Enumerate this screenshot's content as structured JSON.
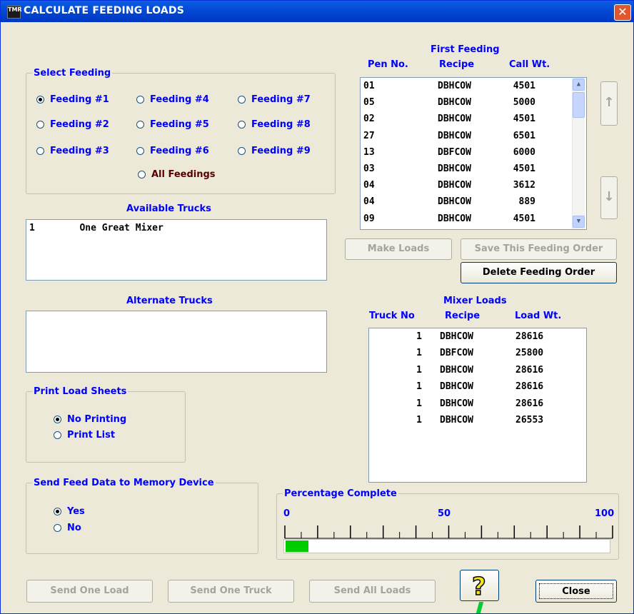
{
  "window": {
    "title": "CALCULATE FEEDING LOADS",
    "icon_text": "TMR"
  },
  "select_feeding": {
    "legend": "Select Feeding",
    "options": [
      "Feeding #1",
      "Feeding #2",
      "Feeding #3",
      "Feeding #4",
      "Feeding #5",
      "Feeding #6",
      "Feeding #7",
      "Feeding #8",
      "Feeding #9"
    ],
    "all_label": "All Feedings",
    "selected": "Feeding #1"
  },
  "available_trucks": {
    "label": "Available Trucks",
    "rows": [
      "1        One Great Mixer"
    ]
  },
  "alternate_trucks": {
    "label": "Alternate Trucks"
  },
  "print_sheets": {
    "legend": "Print Load Sheets",
    "options": [
      "No Printing",
      "Print List"
    ],
    "selected": "No Printing"
  },
  "send_feed": {
    "legend": "Send Feed Data to Memory Device",
    "options": [
      "Yes",
      "No"
    ],
    "selected": "Yes"
  },
  "first_feeding": {
    "title": "First Feeding",
    "headers": [
      "Pen No.",
      "Recipe",
      "Call Wt."
    ],
    "rows": [
      [
        "01",
        "DBHCOW",
        "4501"
      ],
      [
        "05",
        "DBHCOW",
        "5000"
      ],
      [
        "02",
        "DBHCOW",
        "4501"
      ],
      [
        "27",
        "DBHCOW",
        "6501"
      ],
      [
        "13",
        "DBFCOW",
        "6000"
      ],
      [
        "03",
        "DBHCOW",
        "4501"
      ],
      [
        "04",
        "DBHCOW",
        "3612"
      ],
      [
        "04",
        "DBHCOW",
        "889"
      ],
      [
        "09",
        "DBHCOW",
        "4501"
      ]
    ]
  },
  "buttons": {
    "make_loads": "Make Loads",
    "save_order": "Save This Feeding Order",
    "delete_order": "Delete Feeding Order",
    "send_one_load": "Send One Load",
    "send_one_truck": "Send One Truck",
    "send_all_loads": "Send All Loads",
    "close": "Close",
    "up_arrow": "↑",
    "down_arrow": "↓",
    "help": "?"
  },
  "mixer_loads": {
    "title": "Mixer Loads",
    "headers": [
      "Truck No",
      "Recipe",
      "Load Wt."
    ],
    "rows": [
      [
        "1",
        "DBHCOW",
        "28616"
      ],
      [
        "1",
        "DBFCOW",
        "25800"
      ],
      [
        "1",
        "DBHCOW",
        "28616"
      ],
      [
        "1",
        "DBHCOW",
        "28616"
      ],
      [
        "1",
        "DBHCOW",
        "28616"
      ],
      [
        "1",
        "DBHCOW",
        "26553"
      ]
    ]
  },
  "progress": {
    "legend": "Percentage Complete",
    "tick_labels": [
      "0",
      "50",
      "100"
    ],
    "percent": 7,
    "bar_color": "#00cc00"
  },
  "colors": {
    "accent_text": "#0000ff",
    "title_bar": "#0043cf",
    "close_button": "#e0562f"
  }
}
